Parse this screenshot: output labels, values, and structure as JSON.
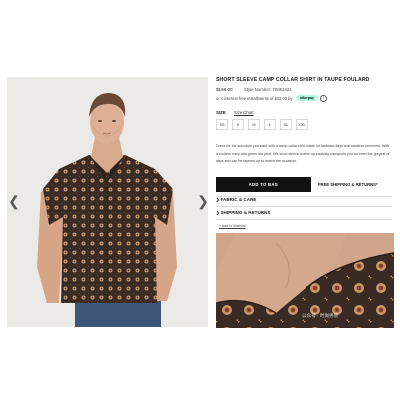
{
  "product": {
    "title": "SHORT SLEEVE CAMP COLLAR SHIRT IN TAUPE FOULARD",
    "price": "$168.00",
    "style_number": "Style Number: 70651421",
    "installments": "or 4 interest-free installments of $42.00 by",
    "afterpay_label": "afterpay",
    "size_label": "SIZE",
    "size_chart_label": "Size Chart",
    "sizes": [
      "XS",
      "S",
      "M",
      "L",
      "XL",
      "XXL"
    ],
    "description": "Dress for the schedule you want with a camp collar shirt made for laidback days and vacation moments. With a modern navy and green dot print, this short sleeve button up instantly transports you on even the greyest of days and can be layered up to match the occasion.",
    "add_to_bag_label": "ADD TO BAG",
    "shipping_label": "FREE SHIPPING & RETURNS*",
    "accordions": [
      {
        "label": "FABRIC & CARE"
      },
      {
        "label": "SHIPPING & RETURNS"
      }
    ],
    "wishlist_label": "+ Add to Wishlist"
  },
  "gallery": {
    "prev_icon": "chevron-left-icon",
    "next_icon": "chevron-right-icon"
  },
  "watermark": "公众号 · 时尚男装",
  "colors": {
    "button_bg": "#111111",
    "afterpay_bg": "#b2fce4",
    "shirt_base": "#3b2b25",
    "print_accent": "#c69a6a",
    "background": "#ffffff"
  }
}
